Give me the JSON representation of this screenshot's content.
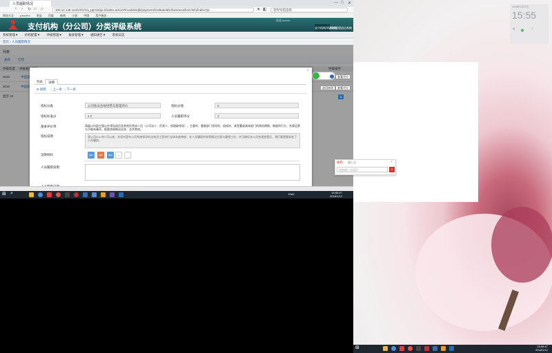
{
  "browser": {
    "tab_title": "人员履职情况",
    "address": "100.12.148.114/s/z/s/z/a_ppmis/pp:2/index.action#/module/qhl/payment/institute/abc/business/ksm/info/index?pr...",
    "search_placeholder": "领导导航指挥",
    "bookmarks": [
      "网站大全",
      "panvero",
      "淘宝",
      "百度",
      "新闻",
      "小说",
      "中国",
      "用户服务"
    ]
  },
  "app": {
    "title": "支付机构（分公司）分类评级系统",
    "user": "欢迎 admin",
    "header_buttons": [
      "支付机构评级系统",
      "系统管理",
      "退出系统"
    ],
    "menu": [
      "系统管理▼",
      "机构配置▼",
      "评级管理▼",
      "报表管理▼",
      "通知通告▼",
      "系统日志"
    ],
    "breadcrumb": [
      "首页",
      "人员履职情况"
    ],
    "page_title": "列表",
    "tools": [
      "查询",
      "打印"
    ],
    "table_headers": [
      "评级年度",
      "评级机构名称",
      "履职情况"
    ],
    "rows": [
      {
        "year": "2016",
        "org": "中国支付公司",
        "action1": "确认评分",
        "action2": "查看评分"
      },
      {
        "year": "2016",
        "org": "中国支付公司",
        "action1": "退回修改",
        "action2": "查看评分"
      }
    ],
    "pagination": {
      "page_size": "10",
      "current": "1"
    },
    "right_header": "评级操作"
  },
  "modal": {
    "tabs": [
      "列表",
      "详细"
    ],
    "nav": [
      "刷新",
      "上一条",
      "下一条"
    ],
    "fields": {
      "score_item_label": "指标分类",
      "score_item_value": "公司依法合规经营与管理评价",
      "score_weight_label": "指标分值",
      "score_weight_value": "6",
      "standard_label": "指标标准分",
      "standard_value": "4.0",
      "self_score_label": "人员履职评分",
      "self_score_value": "3",
      "basis_label": "基本评价项",
      "basis_text": "高级以内部主管以外领导成员及其他负责成人员（公司法人、负责人、经理级领导）、主要的、重要部门领导的、组成的、其签署或具体部门的原创建制、制度的行为、合规运营与不能有事项、报管违规移动业务、业余其他。",
      "note_label": "指标说明",
      "note_text": "我公司2014年7月以来，年初对是年公司系统领导的全体员工是进行全体年度审核、在人员履职的和等情况方面与重视工作，并且做好本公司合规经营后、我们要更要标准了人员履职。",
      "attach_label": "证明材料",
      "attachments": [
        "doc",
        "pdf",
        "doc"
      ],
      "add_label": "+",
      "more_label": "…",
      "comment_label": "人员履职说明",
      "comment2_label": "人员履职日期"
    }
  },
  "taskbar_left": {
    "time": "15:55:47",
    "date": "2018/1/12",
    "lang": "ENG"
  },
  "desktop_widget": {
    "time": "15:55",
    "date": "2018年1月12日",
    "weather": "晴",
    "temp": "7°"
  },
  "sogou": {
    "title": "搜狗",
    "mode": "输入法",
    "placeholder": "搜狗输入法网页"
  },
  "taskbar_right": {
    "time": "15:55:47",
    "date": "2018/1/12"
  }
}
